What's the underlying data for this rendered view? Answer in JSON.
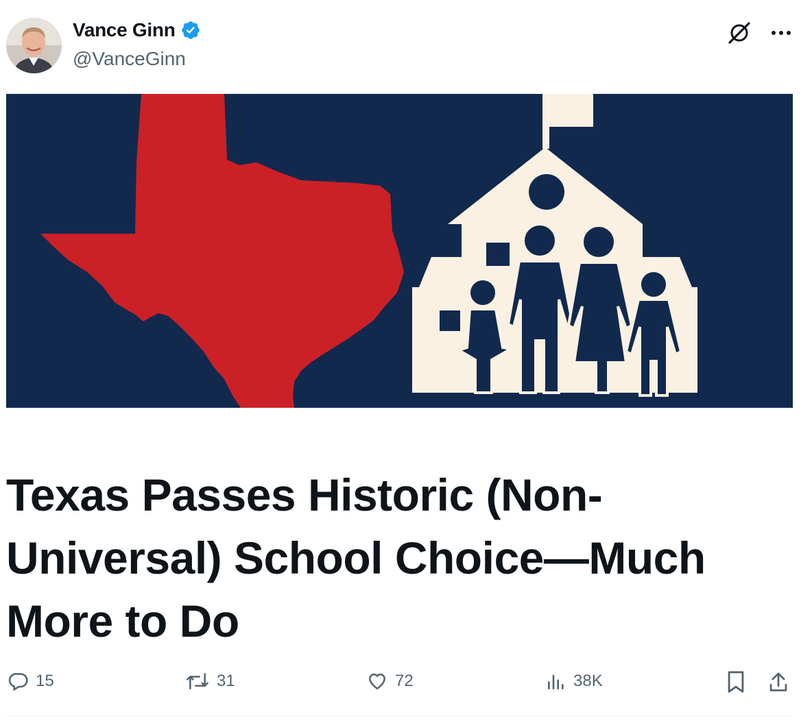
{
  "author": {
    "name": "Vance Ginn",
    "handle": "@VanceGinn",
    "verified": true
  },
  "top_actions": {
    "grok_icon": "grok-icon",
    "more_icon": "more-options-icon"
  },
  "hero_image": {
    "description_icons": [
      "texas-map",
      "schoolhouse",
      "family"
    ],
    "colors": {
      "background": "#11294d",
      "texas": "#cc2027",
      "house": "#fbf1e3"
    }
  },
  "headline": "Texas Passes Historic (Non-Universal) School Choice—Much More to Do",
  "engagement": {
    "replies": "15",
    "reposts": "31",
    "likes": "72",
    "views": "38K"
  },
  "colors": {
    "text": "#0f1419",
    "secondary": "#536471",
    "verified": "#1d9bf0"
  }
}
